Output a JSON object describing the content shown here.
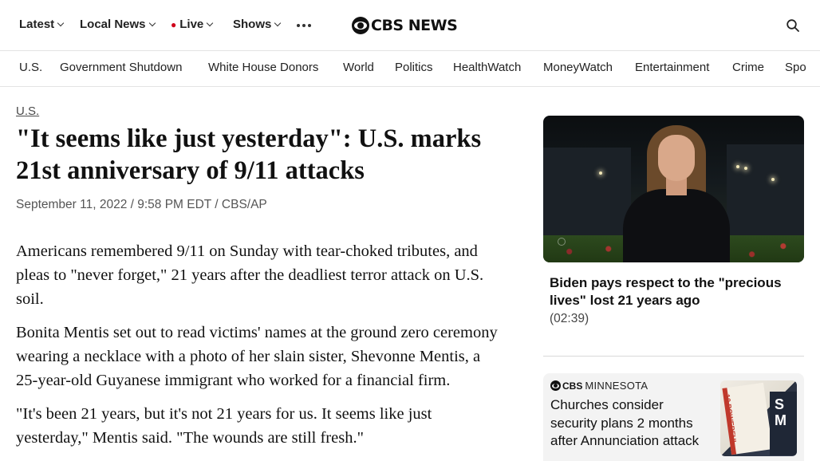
{
  "header": {
    "nav": [
      {
        "label": "Latest",
        "has_menu": true
      },
      {
        "label": "Local News",
        "has_menu": true
      },
      {
        "label": "Live",
        "has_menu": true,
        "live": true
      },
      {
        "label": "Shows",
        "has_menu": true
      }
    ],
    "logo_text": "CBS NEWS",
    "icons": {
      "more": "more-horizontal-icon",
      "search": "search-icon"
    }
  },
  "subnav": {
    "items": [
      "U.S.",
      "Government Shutdown",
      "White House Donors",
      "World",
      "Politics",
      "HealthWatch",
      "MoneyWatch",
      "Entertainment",
      "Crime",
      "Spo"
    ]
  },
  "article": {
    "section": "U.S.",
    "headline": "\"It seems like just yesterday\": U.S. marks 21st anniversary of 9/11 attacks",
    "date": "September 11, 2022 / 9:58 PM EDT",
    "separator": " / ",
    "source": "CBS/AP",
    "paragraphs": [
      "Americans remembered 9/11 on Sunday with tear-choked tributes, and pleas to \"never forget,\" 21 years after the deadliest terror attack on U.S. soil.",
      "Bonita Mentis set out to read victims' names at the ground zero ceremony wearing a necklace with a photo of her slain sister, Shevonne Mentis, a 25-year-old Guyanese immigrant who worked for a financial firm.",
      "\"It's been 21 years, but it's not 21 years for us. It seems like just yesterday,\" Mentis said. \"The wounds are still fresh.\""
    ]
  },
  "rail": {
    "video": {
      "title": "Biden pays respect to the \"precious lives\" lost 21 years ago",
      "duration": "(02:39)"
    },
    "story": {
      "affiliate_brand": "CBS",
      "affiliate_market": "MINNESOTA",
      "title": "Churches consider security plans 2 months after Annunciation attack",
      "thumb_text_1": "10 POWERFUL",
      "thumb_text_2": "S M"
    }
  },
  "colors": {
    "live_dot": "#d0021b",
    "text": "#111111",
    "muted": "#555555",
    "divider": "#e3e3e3"
  }
}
